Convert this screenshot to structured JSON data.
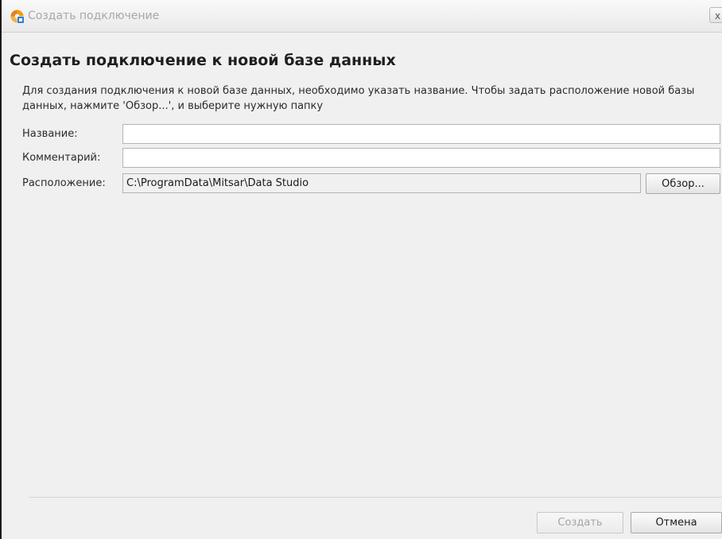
{
  "window": {
    "title": "Создать подключение",
    "close_label": "x"
  },
  "heading": "Создать подключение к новой базе данных",
  "description": "Для создания подключения к новой базе данных, необходимо указать название. Чтобы задать расположение новой базы данных, нажмите 'Обзор...', и выберите нужную папку",
  "fields": {
    "name": {
      "label": "Название:",
      "value": ""
    },
    "comment": {
      "label": "Комментарий:",
      "value": ""
    },
    "location": {
      "label": "Расположение:",
      "value": "C:\\ProgramData\\Mitsar\\Data Studio"
    }
  },
  "buttons": {
    "browse": "Обзор...",
    "create": "Создать",
    "cancel": "Отмена"
  },
  "colors": {
    "app_icon_orange": "#f39c12",
    "app_icon_blue": "#2a7fd4",
    "title_text": "#a8a8a8",
    "disabled_text": "#a5a5a5"
  },
  "icons": {
    "app": "app-logo-icon",
    "close": "close-icon"
  }
}
